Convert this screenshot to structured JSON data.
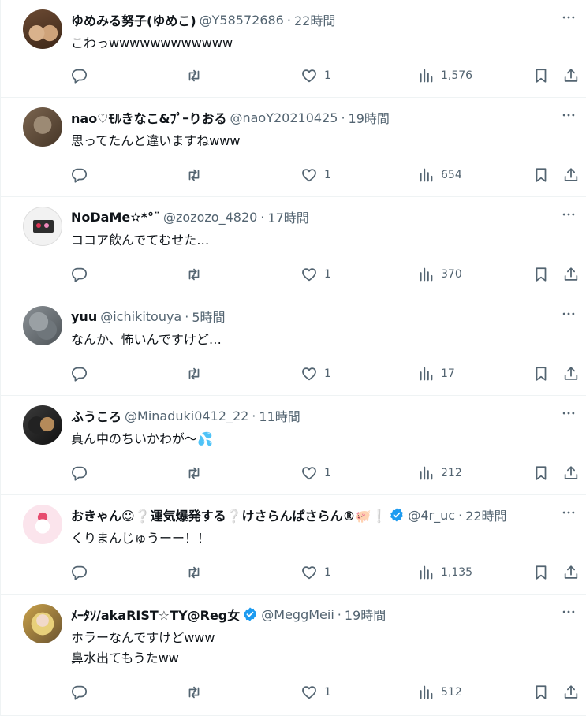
{
  "colors": {
    "icon": "#536471",
    "verified": "#1d9bf0",
    "border": "#eff3f4"
  },
  "icons": {
    "reply": "reply-icon",
    "retweet": "retweet-icon",
    "like": "heart-icon",
    "views": "views-icon",
    "bookmark": "bookmark-icon",
    "share": "share-icon",
    "more": "more-icon"
  },
  "tweets": [
    {
      "name": "ゆめみる努子(ゆめこ)",
      "handle": "@Y58572686",
      "time": "22時間",
      "text": "こわっwwwwwwwwwwww",
      "likes": "1",
      "views": "1,576",
      "verified": false
    },
    {
      "name": "nao♡ﾓﾙきなこ&ﾌﾟｰりおる",
      "handle": "@naoY20210425",
      "time": "19時間",
      "text": "思ってたんと違いますねwww",
      "likes": "1",
      "views": "654",
      "verified": false
    },
    {
      "name": "NoDaMe✫*°¨",
      "handle": "@zozozo_4820",
      "time": "17時間",
      "text": "ココア飲んでてむせた…",
      "likes": "1",
      "views": "370",
      "verified": false
    },
    {
      "name": "yuu",
      "handle": "@ichikitouya",
      "time": "5時間",
      "text": "なんか、怖いんですけど…",
      "likes": "1",
      "views": "17",
      "verified": false
    },
    {
      "name": "ふうころ",
      "handle": "@Minaduki0412_22",
      "time": "11時間",
      "text": "真ん中のちいかわが～💦",
      "likes": "1",
      "views": "212",
      "verified": false
    },
    {
      "name": "おきゃん☺❔運気爆発する❔けさらんぱさらん®🐖❕",
      "handle": "@4r_uc",
      "time": "22時間",
      "text": "くりまんじゅうーー！！",
      "likes": "1",
      "views": "1,135",
      "verified": true
    },
    {
      "name": "ﾒｰﾀｿ/akaRIST☆TY@Reg女",
      "handle": "@MeggMeii",
      "time": "19時間",
      "text": "ホラーなんですけどwww\n鼻水出てもうたww",
      "likes": "1",
      "views": "512",
      "verified": true
    }
  ]
}
